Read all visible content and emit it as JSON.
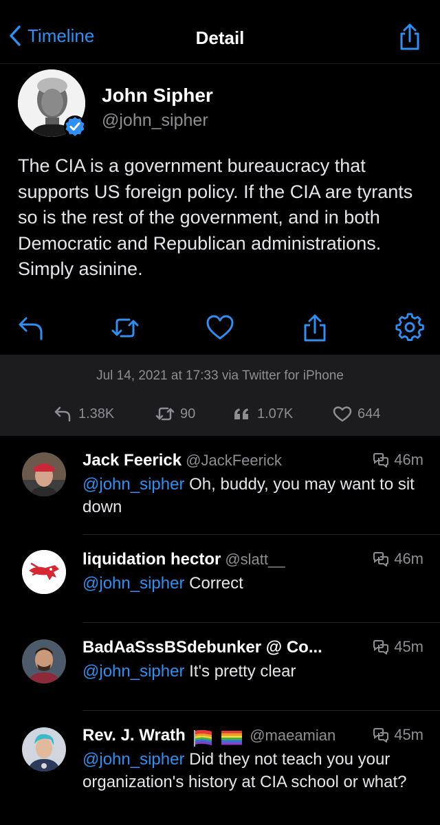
{
  "nav": {
    "back_label": "Timeline",
    "title": "Detail"
  },
  "tweet": {
    "author_name": "John Sipher",
    "author_handle": "@john_sipher",
    "text": "The CIA is a government bureaucracy that supports US foreign policy. If the CIA are tyrants so is the rest of the government, and in both Democratic and Republican administrations. Simply asinine.",
    "date_line": "Jul 14, 2021 at 17:33 via Twitter for iPhone",
    "stats": {
      "replies": "1.38K",
      "retweets": "90",
      "quotes": "1.07K",
      "likes": "644"
    },
    "actions": [
      "reply-icon",
      "retweet-icon",
      "heart-icon",
      "share-icon",
      "gear-icon"
    ]
  },
  "replies": [
    {
      "name": "Jack Feerick",
      "handle": "@JackFeerick",
      "time": "46m",
      "mention": "@john_sipher",
      "text": " Oh, buddy, you may want to sit down"
    },
    {
      "name": "liquidation hector",
      "handle": "@slatt__",
      "time": "46m",
      "mention": "@john_sipher",
      "text": " Correct"
    },
    {
      "name": "BadAaSssBSdebunker @ Co...",
      "handle": "",
      "time": "45m",
      "mention": "@john_sipher",
      "text": " It's pretty clear"
    },
    {
      "name": "Rev. J. Wrath",
      "handle": "@maeamian",
      "time": "45m",
      "mention": "@john_sipher",
      "text": " Did they not teach you your organization's history at CIA school or what?"
    }
  ],
  "colors": {
    "accent": "#2f8ff2",
    "background": "#000000",
    "panel": "#1c1c1e",
    "secondary_text": "#8e8e93"
  }
}
